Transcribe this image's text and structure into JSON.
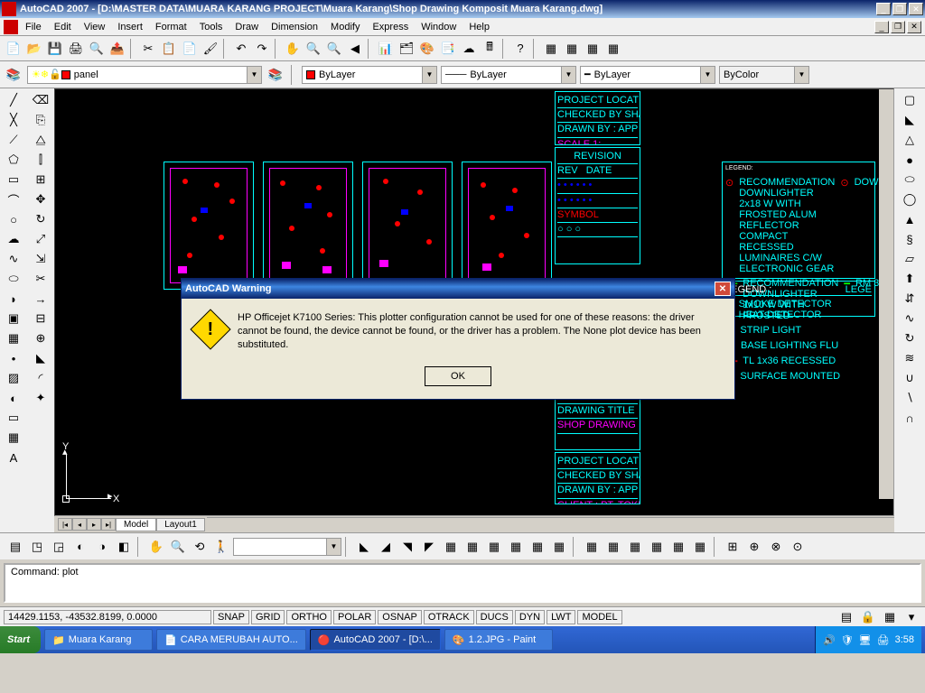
{
  "title": "AutoCAD 2007 - [D:\\MASTER DATA\\MUARA KARANG PROJECT\\Muara Karang\\Shop Drawing Komposit Muara Karang.dwg]",
  "menus": [
    "File",
    "Edit",
    "View",
    "Insert",
    "Format",
    "Tools",
    "Draw",
    "Dimension",
    "Modify",
    "Express",
    "Window",
    "Help"
  ],
  "layer_combo": "panel",
  "prop_combos": {
    "color": "ByLayer",
    "linetype": "ByLayer",
    "lineweight": "ByLayer",
    "plotstyle": "ByColor"
  },
  "tabs": {
    "active": "Model",
    "other": "Layout1"
  },
  "command": "Command: plot",
  "status_coords": "14429.1153, -43532.8199, 0.0000",
  "status_toggles": [
    "SNAP",
    "GRID",
    "ORTHO",
    "POLAR",
    "OSNAP",
    "OTRACK",
    "DUCS",
    "DYN",
    "LWT",
    "MODEL"
  ],
  "dialog": {
    "title": "AutoCAD Warning",
    "text": "HP Officejet K7100 Series: This plotter configuration cannot be used for one of these reasons: the driver cannot be found, the device cannot be found, or the driver has a problem. The None plot device has been substituted.",
    "ok": "OK"
  },
  "taskbar": {
    "start": "Start",
    "items": [
      "Muara Karang",
      "CARA MERUBAH AUTO...",
      "AutoCAD 2007 - [D:\\...",
      "1.2.JPG - Paint"
    ],
    "clock": "3:58"
  },
  "drawing": {
    "legend_title": "LEGEND:",
    "legend_title2": "LEGEND :",
    "legend_items": [
      "SMOKE DETECTOR",
      "HEAT DETECTOR"
    ],
    "ucs": {
      "x": "X",
      "y": "Y"
    }
  }
}
